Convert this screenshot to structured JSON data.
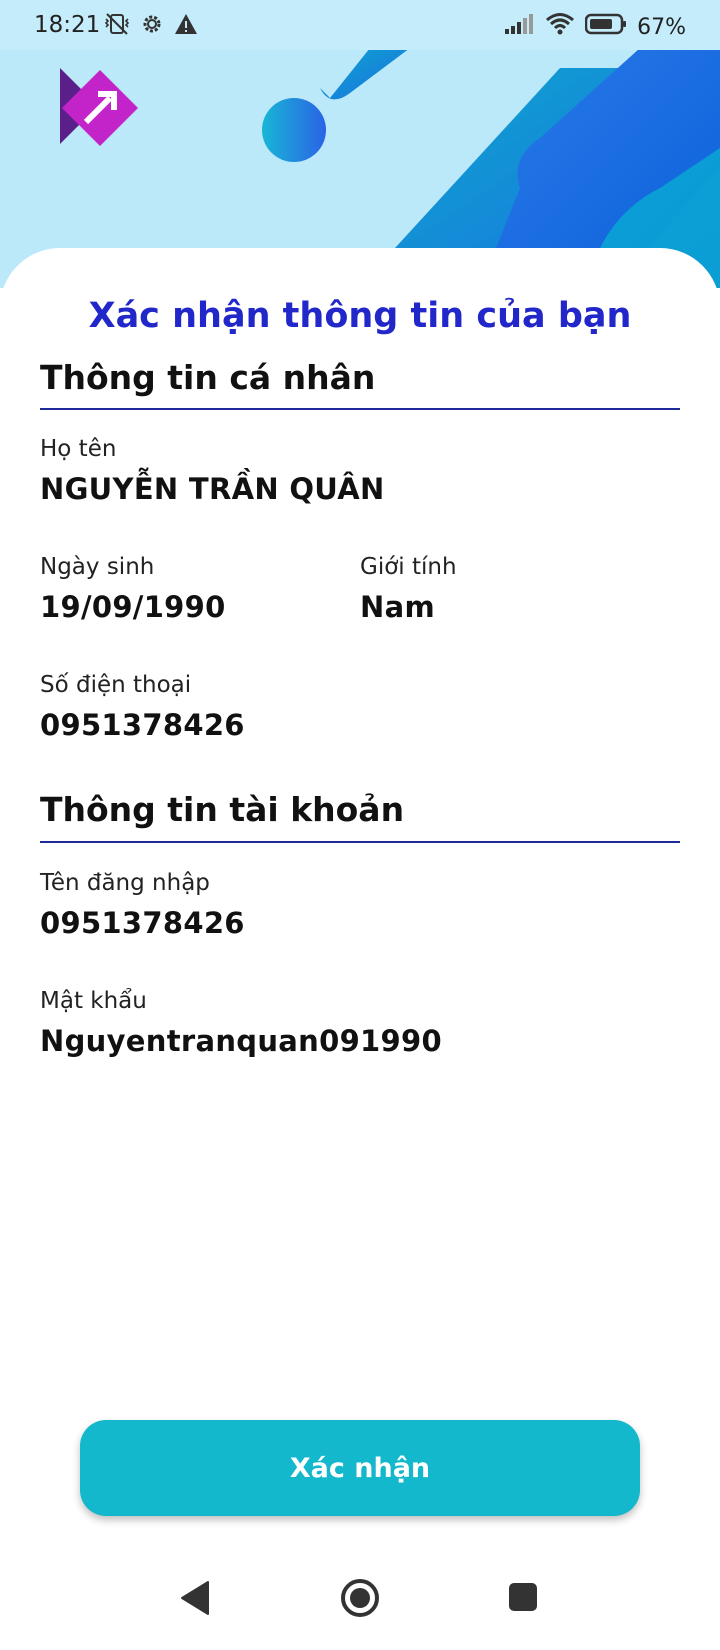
{
  "status_bar": {
    "time": "18:21",
    "battery_text": "67%",
    "left_icons": [
      "vibrate-off-icon",
      "gear-icon",
      "warning-icon"
    ],
    "right_icons": [
      "signal-icon",
      "wifi-icon",
      "battery-icon"
    ]
  },
  "colors": {
    "title_blue": "#2127c8",
    "button": "#14b8cc",
    "header_bg": "#bce9fa",
    "logo_purple": "#c324c9"
  },
  "page": {
    "title": "Xác nhận thông tin của bạn"
  },
  "personal": {
    "section_title": "Thông tin cá nhân",
    "name_label": "Họ tên",
    "name_value": "NGUYỄN TRẦN QUÂN",
    "dob_label": "Ngày sinh",
    "dob_value": "19/09/1990",
    "gender_label": "Giới tính",
    "gender_value": "Nam",
    "phone_label": "Số điện thoại",
    "phone_value": "0951378426"
  },
  "account": {
    "section_title": "Thông tin tài khoản",
    "username_label": "Tên đăng nhập",
    "username_value": "0951378426",
    "password_label": "Mật khẩu",
    "password_value": "Nguyentranquan091990"
  },
  "actions": {
    "confirm_label": "Xác nhận"
  },
  "nav_bar": {
    "icons": [
      "back-icon",
      "home-icon",
      "recents-icon"
    ]
  }
}
